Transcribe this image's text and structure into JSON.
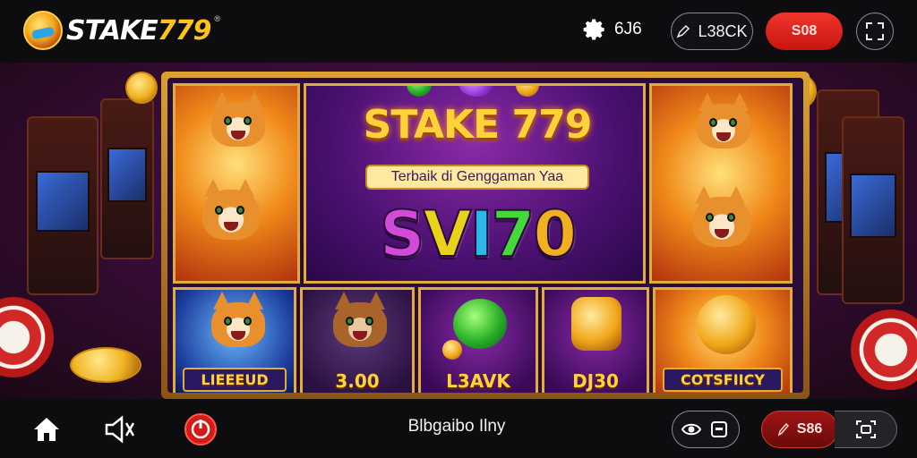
{
  "header": {
    "brand_prefix": "STAKE",
    "brand_suffix": "779",
    "brand_mark": "®",
    "settings_value": "6J6",
    "login_label": "L38CK",
    "red_button_label": "S08",
    "icons": {
      "logo": "casino-logo-icon",
      "settings": "gear-icon",
      "login": "pen-icon",
      "scan": "scan-icon"
    }
  },
  "banner": {
    "title": "STAKE 779",
    "tagline": "Terbaik di Genggaman Yaa",
    "big_word": "SVI70",
    "big_word_colors": [
      "#d14ad8",
      "#e8d21a",
      "#2ab8e8",
      "#45d83a",
      "#f0b020"
    ],
    "reels": [
      {
        "label": "LIEEEUD",
        "style": "plate"
      },
      {
        "label": "3.00",
        "style": "text"
      },
      {
        "label": "L3AVK",
        "style": "text"
      },
      {
        "label": "DJ30",
        "style": "text"
      },
      {
        "label": "COTSFIICY",
        "style": "plate"
      }
    ]
  },
  "footer": {
    "home_icon": "home-icon",
    "sound_icon": "speaker-icon",
    "badge_icon": "red-coin-icon",
    "title": "Blbgaibo Ilny",
    "eye_icon": "eye-icon",
    "square_icon": "square-icon",
    "balance_label": "S86",
    "balance_icon": "pen-icon",
    "camera_icon": "camera-icon"
  },
  "colors": {
    "accent_red": "#e0231c",
    "gold": "#ffc21a",
    "bar_bg": "#0d0d10"
  }
}
